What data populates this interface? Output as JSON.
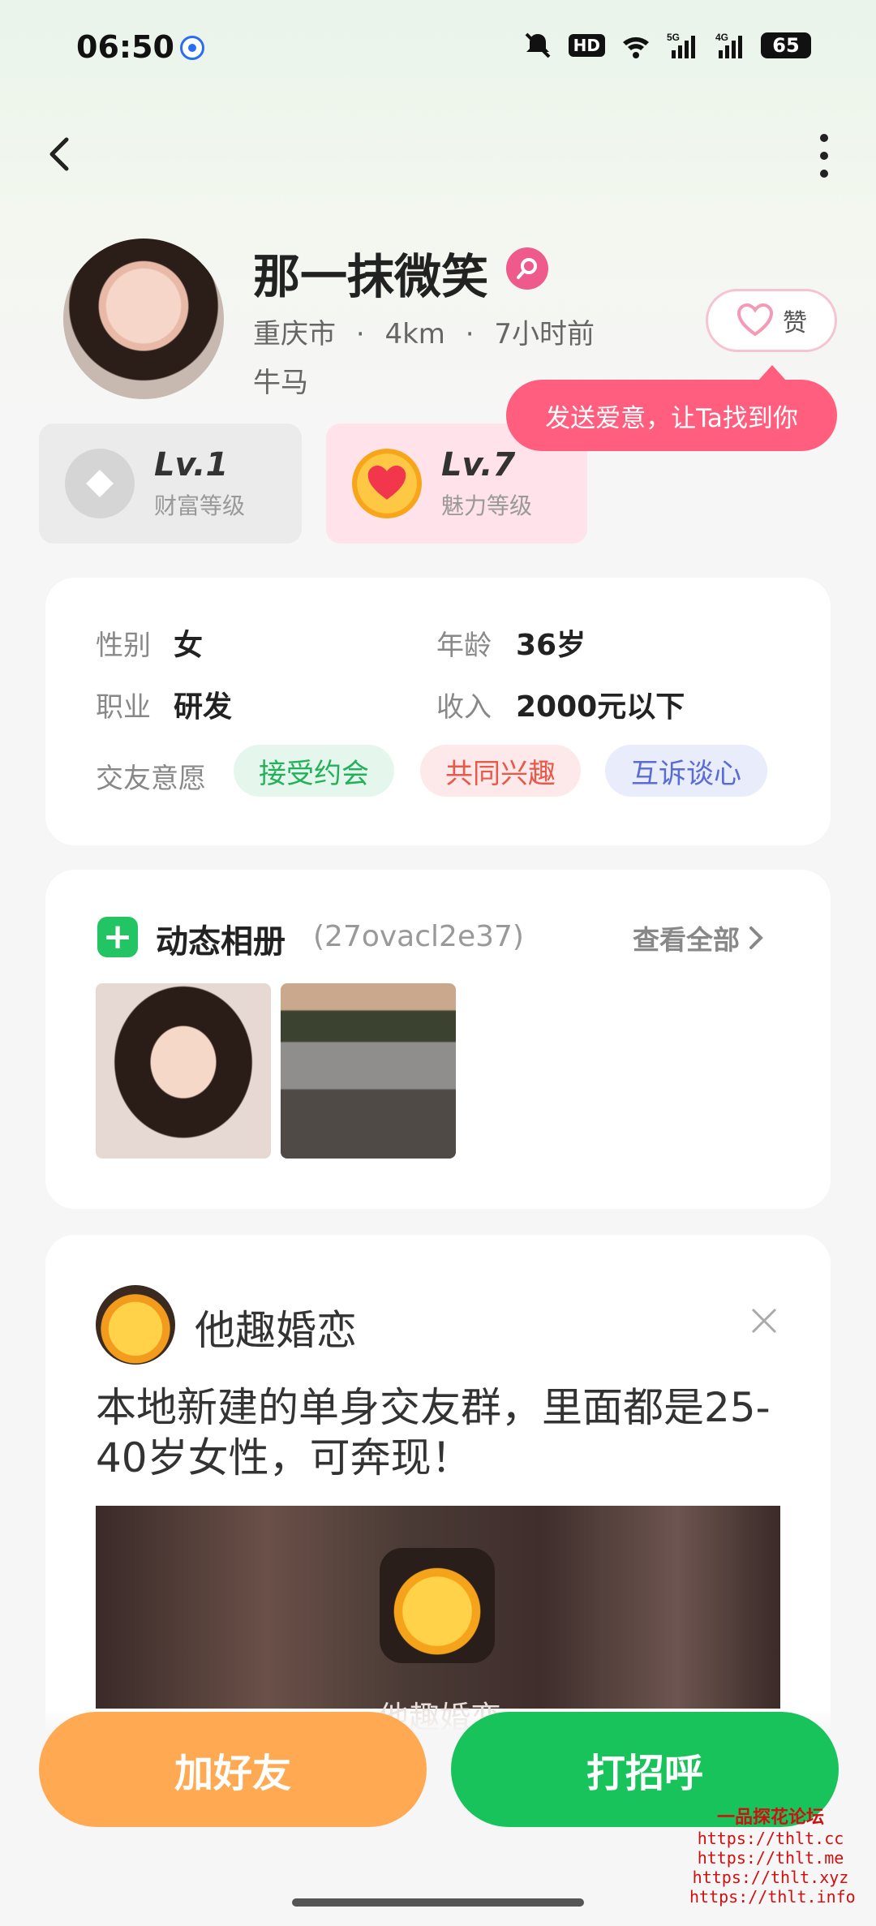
{
  "status_bar": {
    "time": "06:50",
    "hd_label": "HD",
    "signal_1": "5G",
    "signal_2": "4G",
    "battery": "65"
  },
  "profile": {
    "name": "那一抹微笑",
    "city": "重庆市",
    "distance": "4km",
    "last_active": "7小时前",
    "tag": "牛马",
    "like_label": "赞",
    "tooltip": "发送爱意，让Ta找到你"
  },
  "levels": {
    "wealth": {
      "value": "Lv.1",
      "label": "财富等级"
    },
    "charm": {
      "value": "Lv.7",
      "label": "魅力等级"
    }
  },
  "info": {
    "gender_label": "性别",
    "gender_value": "女",
    "age_label": "年龄",
    "age_value": "36岁",
    "job_label": "职业",
    "job_value": "研发",
    "income_label": "收入",
    "income_value": "2000元以下",
    "intent_label": "交友意愿",
    "intents": [
      "接受约会",
      "共同兴趣",
      "互诉谈心"
    ]
  },
  "album": {
    "title": "动态相册",
    "code": "(27ovacl2e37)",
    "view_all": "查看全部"
  },
  "ad": {
    "brand": "他趣婚恋",
    "text": "本地新建的单身交友群，里面都是25-40岁女性，可奔现！",
    "app_name": "他趣婚恋"
  },
  "actions": {
    "add_friend": "加好友",
    "greet": "打招呼"
  },
  "watermark": {
    "title": "一品探花论坛",
    "urls": [
      "https://thlt.cc",
      "https://thlt.me",
      "https://thlt.xyz",
      "https://thlt.info"
    ]
  },
  "colors": {
    "primary_green": "#18c35c",
    "add_orange": "#ffaa52",
    "tooltip_pink": "#ff5e7e"
  }
}
